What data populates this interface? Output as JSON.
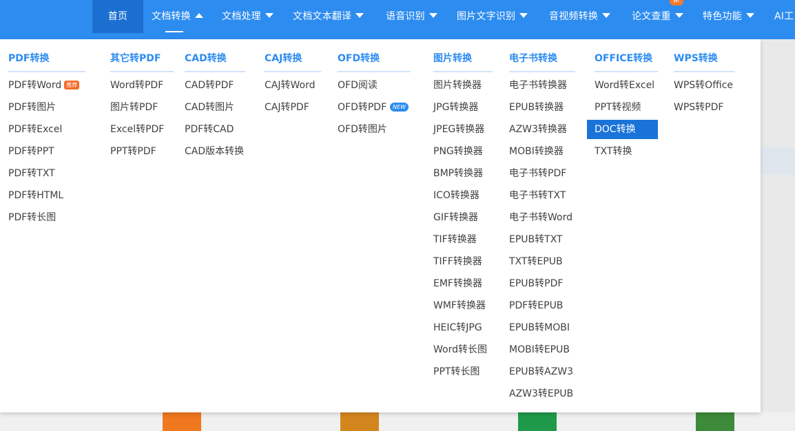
{
  "nav": {
    "items": [
      {
        "label": "首页"
      },
      {
        "label": "文档转换"
      },
      {
        "label": "文档处理"
      },
      {
        "label": "文档文本翻译"
      },
      {
        "label": "语音识别"
      },
      {
        "label": "图片文字识别"
      },
      {
        "label": "音视频转换"
      },
      {
        "label": "论文查重",
        "badge": "新"
      },
      {
        "label": "特色功能"
      },
      {
        "label": "AI工"
      }
    ]
  },
  "menu": {
    "columns": [
      {
        "title": "PDF转换",
        "items": [
          {
            "label": "PDF转Word",
            "tag": "推荐"
          },
          {
            "label": "PDF转图片"
          },
          {
            "label": "PDF转Excel"
          },
          {
            "label": "PDF转PPT"
          },
          {
            "label": "PDF转TXT"
          },
          {
            "label": "PDF转HTML"
          },
          {
            "label": "PDF转长图"
          }
        ]
      },
      {
        "title": "其它转PDF",
        "items": [
          {
            "label": "Word转PDF"
          },
          {
            "label": "图片转PDF"
          },
          {
            "label": "Excel转PDF"
          },
          {
            "label": "PPT转PDF"
          }
        ]
      },
      {
        "title": "CAD转换",
        "items": [
          {
            "label": "CAD转PDF"
          },
          {
            "label": "CAD转图片"
          },
          {
            "label": "PDF转CAD"
          },
          {
            "label": "CAD版本转换"
          }
        ]
      },
      {
        "title": "CAJ转换",
        "items": [
          {
            "label": "CAJ转Word"
          },
          {
            "label": "CAJ转PDF"
          }
        ]
      },
      {
        "title": "OFD转换",
        "items": [
          {
            "label": "OFD阅读"
          },
          {
            "label": "OFD转PDF",
            "tag": "NEW"
          },
          {
            "label": "OFD转图片"
          }
        ]
      },
      {
        "title": "图片转换",
        "items": [
          {
            "label": "图片转换器"
          },
          {
            "label": "JPG转换器"
          },
          {
            "label": "JPEG转换器"
          },
          {
            "label": "PNG转换器"
          },
          {
            "label": "BMP转换器"
          },
          {
            "label": "ICO转换器"
          },
          {
            "label": "GIF转换器"
          },
          {
            "label": "TIF转换器"
          },
          {
            "label": "TIFF转换器"
          },
          {
            "label": "EMF转换器"
          },
          {
            "label": "WMF转换器"
          },
          {
            "label": "HEIC转JPG"
          },
          {
            "label": "Word转长图"
          },
          {
            "label": "PPT转长图"
          }
        ]
      },
      {
        "title": "电子书转换",
        "items": [
          {
            "label": "电子书转换器"
          },
          {
            "label": "EPUB转换器"
          },
          {
            "label": "AZW3转换器"
          },
          {
            "label": "MOBI转换器"
          },
          {
            "label": "电子书转PDF"
          },
          {
            "label": "电子书转TXT"
          },
          {
            "label": "电子书转Word"
          },
          {
            "label": "EPUB转TXT"
          },
          {
            "label": "TXT转EPUB"
          },
          {
            "label": "EPUB转PDF"
          },
          {
            "label": "PDF转EPUB"
          },
          {
            "label": "EPUB转MOBI"
          },
          {
            "label": "MOBI转EPUB"
          },
          {
            "label": "EPUB转AZW3"
          },
          {
            "label": "AZW3转EPUB"
          }
        ]
      },
      {
        "title": "OFFICE转换",
        "items": [
          {
            "label": "Word转Excel"
          },
          {
            "label": "PPT转视频"
          },
          {
            "label": "DOC转换",
            "active": true
          },
          {
            "label": "TXT转换"
          }
        ]
      },
      {
        "title": "WPS转换",
        "items": [
          {
            "label": "WPS转Office"
          },
          {
            "label": "WPS转PDF"
          }
        ]
      }
    ]
  },
  "colors": {
    "nav_bg": "#2d8cf0",
    "nav_active_bg": "#1b6fd0",
    "heading": "#2d8cf0",
    "item_text": "#404040",
    "active_bg": "#1a73d8",
    "hot_tag": "#f56c2c",
    "new_tag": "#2d8cf0"
  }
}
